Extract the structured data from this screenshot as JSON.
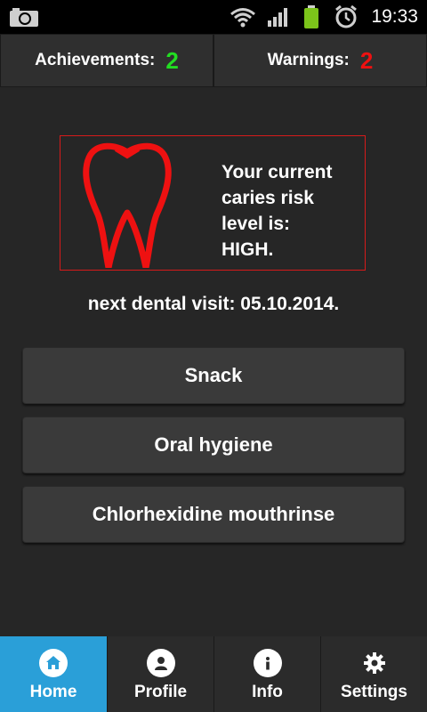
{
  "status_bar": {
    "time": "19:33",
    "icons": [
      "camera-icon",
      "wifi-icon",
      "signal-icon",
      "battery-icon",
      "alarm-icon"
    ]
  },
  "counters": {
    "achievements_label": "Achievements:",
    "achievements_value": "2",
    "warnings_label": "Warnings:",
    "warnings_value": "2",
    "colors": {
      "achievements": "#22dd22",
      "warnings": "#ee1111"
    }
  },
  "risk": {
    "lines": [
      "Your current",
      "caries risk",
      "level is:",
      "HIGH."
    ],
    "icon": "tooth-icon",
    "accent": "#ee1111"
  },
  "next_visit": "next dental visit: 05.10.2014.",
  "buttons": {
    "snack": "Snack",
    "oral_hygiene": "Oral hygiene",
    "chlorhexidine": "Chlorhexidine mouthrinse"
  },
  "nav": {
    "items": [
      {
        "label": "Home",
        "icon": "home-icon",
        "active": true
      },
      {
        "label": "Profile",
        "icon": "profile-icon",
        "active": false
      },
      {
        "label": "Info",
        "icon": "info-icon",
        "active": false
      },
      {
        "label": "Settings",
        "icon": "gear-icon",
        "active": false
      }
    ],
    "active_color": "#2a9fd8"
  }
}
